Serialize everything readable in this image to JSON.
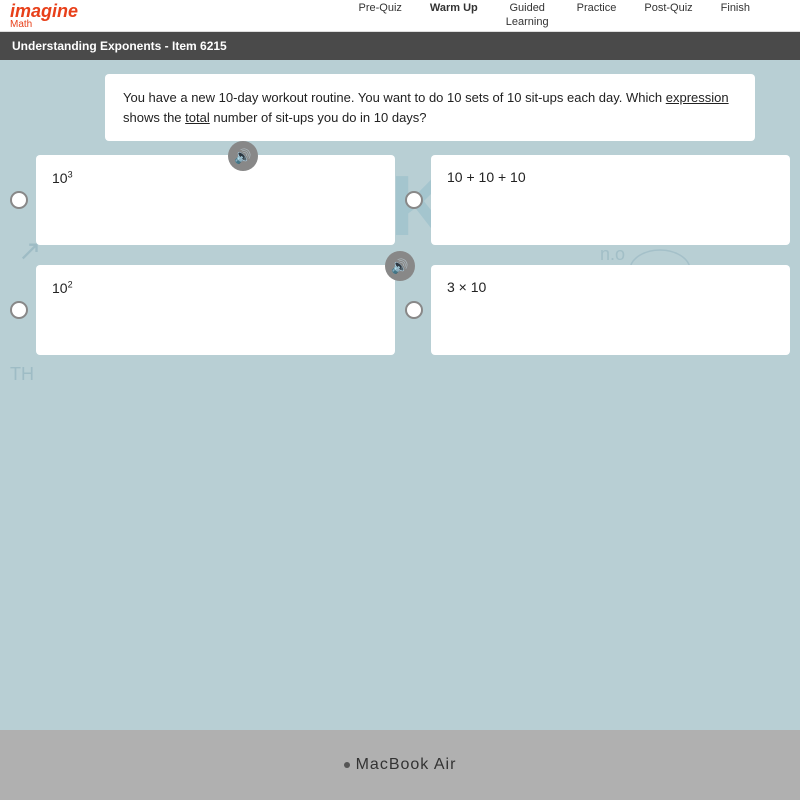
{
  "nav": {
    "logo": "imagine",
    "logo_sub": "Math",
    "items": [
      {
        "label": "Pre-Quiz",
        "active": false
      },
      {
        "label": "Warm Up",
        "active": true
      },
      {
        "label": "Guided\nLearning",
        "active": false
      },
      {
        "label": "Practice",
        "active": false
      },
      {
        "label": "Post-Quiz",
        "active": false
      },
      {
        "label": "Finish",
        "active": false
      }
    ]
  },
  "breadcrumb": {
    "text": "Understanding Exponents - Item 6215"
  },
  "question": {
    "text": "You have a new 10-day workout routine. You want to do 10 sets of 10 sit-ups each day. Which expression shows the total number of sit-ups you do in 10 days?"
  },
  "options": [
    {
      "id": "A",
      "base": "10",
      "exp": "3",
      "display": "10³",
      "has_audio": true
    },
    {
      "id": "B",
      "display": "10 + 10 + 10",
      "has_audio": false
    },
    {
      "id": "C",
      "base": "10",
      "exp": "2",
      "display": "10²",
      "has_audio": true
    },
    {
      "id": "D",
      "display": "3 × 10",
      "has_audio": false
    }
  ],
  "think_watermark": "THiNK",
  "footer": {
    "dot": "·",
    "label": "MacBook Air"
  }
}
